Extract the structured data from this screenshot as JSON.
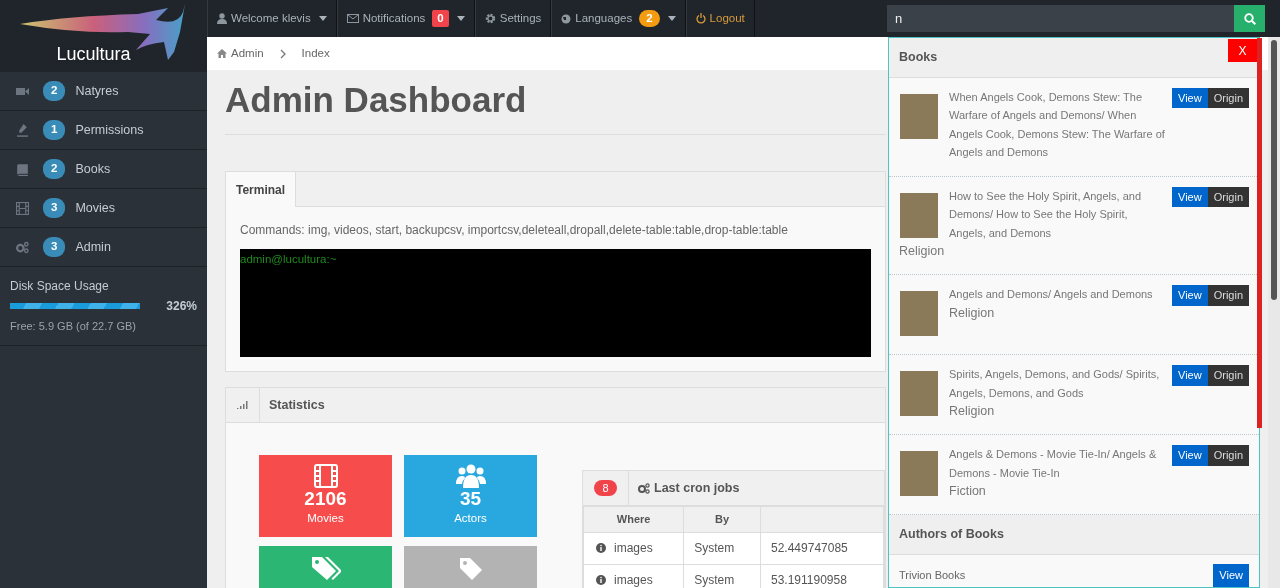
{
  "logo": {
    "text": "Lucultura"
  },
  "topnav": [
    {
      "label": "Welcome klevis",
      "kind": "dropdown"
    },
    {
      "label": "Notifications",
      "kind": "dropdown",
      "badge": "0",
      "color": "#f0434a"
    },
    {
      "label": "Settings",
      "kind": "link"
    },
    {
      "label": "Languages",
      "kind": "dropdown",
      "badge": "2",
      "color": "#f39c12"
    },
    {
      "label": "Logout",
      "kind": "logout"
    }
  ],
  "search": {
    "value": "n"
  },
  "sidebar": {
    "items": [
      {
        "badge": "2",
        "label": "Natyres"
      },
      {
        "badge": "1",
        "label": "Permissions"
      },
      {
        "badge": "2",
        "label": "Books"
      },
      {
        "badge": "3",
        "label": "Movies"
      },
      {
        "badge": "3",
        "label": "Admin"
      }
    ],
    "disk": {
      "title": "Disk Space Usage",
      "level": 1,
      "reading": "326%",
      "free": "Free: 5.9 GB (of 22.7 GB)"
    }
  },
  "breadcrumb": [
    "Admin",
    "Index"
  ],
  "page_title": "Admin Dashboard",
  "terminal": {
    "tabs": [
      {
        "label": "Terminal",
        "selected": true
      }
    ],
    "commands": "Commands: img, videos, start, backupcsv, importcsv,deleteall,dropall,delete-table:table,drop-table:table",
    "prompt": "admin@lucultura:~"
  },
  "statistics": {
    "title": "Statistics",
    "tiles": [
      {
        "value": "2106",
        "label": "Movies",
        "color": "#f74c4c"
      },
      {
        "value": "35",
        "label": "Actors",
        "color": "#29a8e0"
      },
      {
        "color": "#2bb673"
      },
      {
        "color": "#b3b3b3"
      }
    ],
    "cron": {
      "count": "8",
      "title": "Last cron jobs",
      "columns": [
        "Where",
        "By"
      ],
      "rows": [
        [
          "images",
          "System",
          "52.449747085"
        ],
        [
          "images",
          "System",
          "53.191190958"
        ]
      ]
    }
  },
  "search_results": {
    "close": "X",
    "sections": [
      {
        "title": "Books",
        "kind": "books",
        "items": [
          {
            "title": "When Angels Cook, Demons Stew: The Warfare of Angels and Demons/ When Angels Cook, Demons Stew: The Warfare of Angels and Demons",
            "actions": [
              "View",
              "Origin"
            ]
          },
          {
            "title": "How to See the Holy Spirit, Angels, and Demons/ How to See the Holy Spirit, Angels, and Demons",
            "category": "Religion",
            "actions": [
              "View",
              "Origin"
            ]
          },
          {
            "title": "Angels and Demons/ Angels and Demons",
            "category": "Religion",
            "actions": [
              "View",
              "Origin"
            ]
          },
          {
            "title": "Spirits, Angels, Demons, and Gods/ Spirits, Angels, Demons, and Gods",
            "category": "Religion",
            "actions": [
              "View",
              "Origin"
            ]
          },
          {
            "title": "Angels & Demons - Movie Tie-In/ Angels & Demons - Movie Tie-In",
            "category": "Fiction",
            "actions": [
              "View",
              "Origin"
            ]
          }
        ]
      },
      {
        "title": "Authors of Books",
        "kind": "authors",
        "items": [
          {
            "name": "Trivion Books",
            "actions": [
              "View"
            ]
          }
        ]
      }
    ]
  }
}
